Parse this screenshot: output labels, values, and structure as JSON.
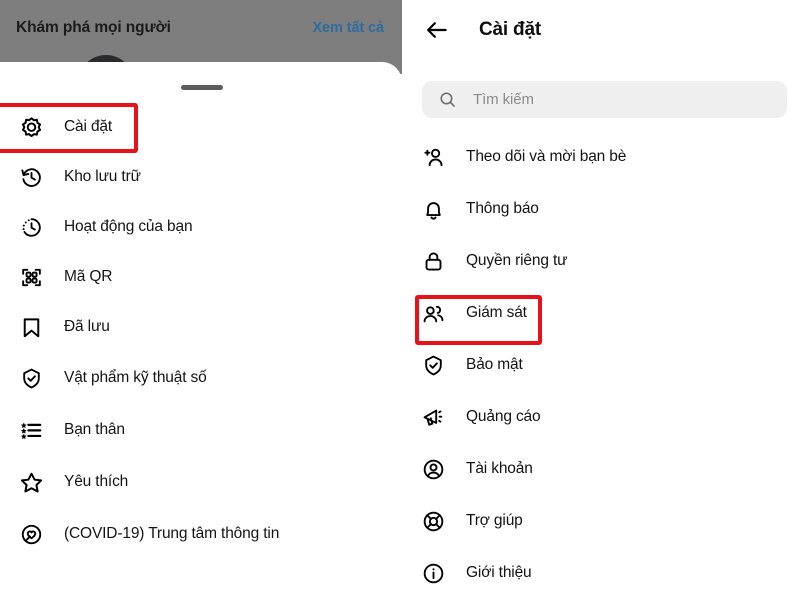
{
  "left_panel": {
    "discover": {
      "title": "Khám phá mọi người",
      "see_all": "Xem tất cả",
      "see_all_color": "#2d6c9f"
    },
    "overlay_color": "#7e7e7e",
    "drag_handle": "drag-handle",
    "menu": [
      {
        "icon": "gear-icon",
        "label": "Cài đặt",
        "highlighted": true
      },
      {
        "icon": "archive-icon",
        "label": "Kho lưu trữ",
        "highlighted": false
      },
      {
        "icon": "activity-icon",
        "label": "Hoạt động của bạn",
        "highlighted": false
      },
      {
        "icon": "qr-code-icon",
        "label": "Mã QR",
        "highlighted": false
      },
      {
        "icon": "bookmark-icon",
        "label": "Đã lưu",
        "highlighted": false
      },
      {
        "icon": "shield-check-icon",
        "label": "Vật phẩm kỹ thuật số",
        "highlighted": false
      },
      {
        "icon": "star-list-icon",
        "label": "Bạn thân",
        "highlighted": false
      },
      {
        "icon": "star-icon",
        "label": "Yêu thích",
        "highlighted": false
      },
      {
        "icon": "covid-heart-icon",
        "label": "(COVID-19) Trung tâm thông tin",
        "highlighted": false
      }
    ]
  },
  "right_panel": {
    "header": {
      "back_icon": "arrow-left-icon",
      "title": "Cài đặt"
    },
    "search": {
      "icon": "search-icon",
      "placeholder": "Tìm kiếm",
      "value": "",
      "background": "#efefef"
    },
    "menu": [
      {
        "icon": "person-add-icon",
        "label": "Theo dõi và mời bạn bè",
        "highlighted": false
      },
      {
        "icon": "bell-icon",
        "label": "Thông báo",
        "highlighted": false
      },
      {
        "icon": "lock-icon",
        "label": "Quyền riêng tư",
        "highlighted": false
      },
      {
        "icon": "people-icon",
        "label": "Giám sát",
        "highlighted": true
      },
      {
        "icon": "shield-check-icon",
        "label": "Bảo mật",
        "highlighted": false
      },
      {
        "icon": "megaphone-icon",
        "label": "Quảng cáo",
        "highlighted": false
      },
      {
        "icon": "account-icon",
        "label": "Tài khoản",
        "highlighted": false
      },
      {
        "icon": "lifebuoy-icon",
        "label": "Trợ giúp",
        "highlighted": false
      },
      {
        "icon": "info-icon",
        "label": "Giới thiệu",
        "highlighted": false
      }
    ]
  },
  "annotations": {
    "highlight_color": "#e8131a",
    "boxes": [
      {
        "target": "Cài đặt",
        "panel": "left"
      },
      {
        "target": "Giám sát",
        "panel": "right"
      }
    ]
  }
}
